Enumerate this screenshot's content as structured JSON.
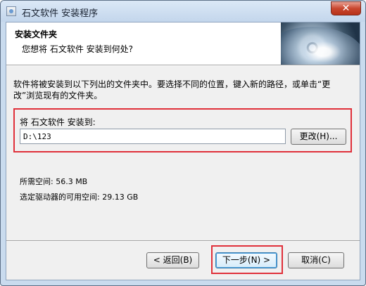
{
  "window": {
    "title": "石文软件 安装程序",
    "close_label": "✕"
  },
  "header": {
    "title": "安装文件夹",
    "subtitle": "您想将 石文软件 安装到何处?"
  },
  "main": {
    "description": "软件将被安装到以下列出的文件夹中。要选择不同的位置，键入新的路径，或单击“更改”浏览现有的文件夹。",
    "install_label": "将 石文软件 安装到:",
    "install_path": "D:\\123",
    "change_button": "更改(H)...",
    "space_required": "所需空间: 56.3 MB",
    "space_available": "选定驱动器的可用空间: 29.13 GB"
  },
  "footer": {
    "back_button": "< 返回(B)",
    "next_button": "下一步(N) >",
    "cancel_button": "取消(C)"
  },
  "colors": {
    "highlight_box": "#e0303a",
    "title_bar": "#c3d6ec"
  }
}
